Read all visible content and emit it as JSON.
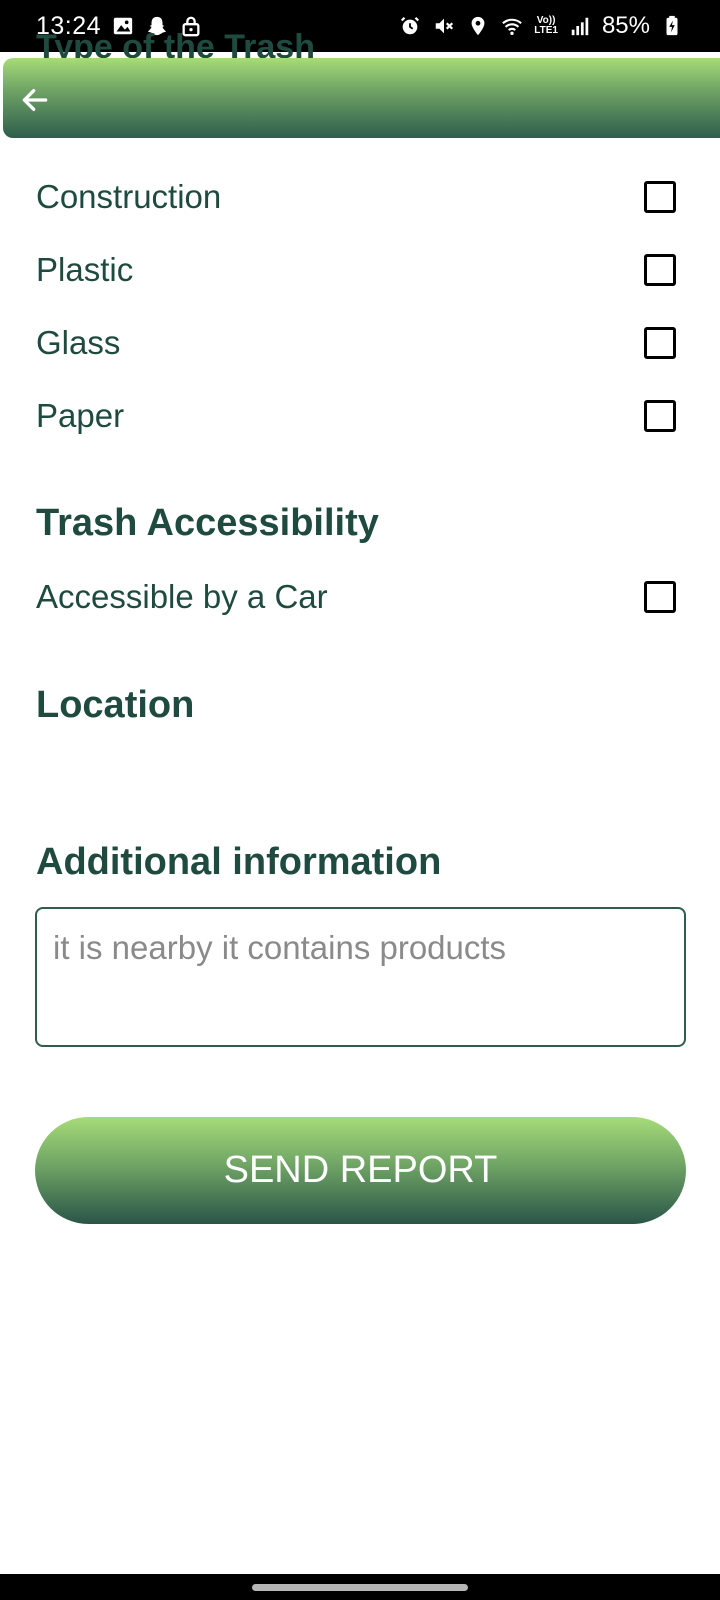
{
  "status_bar": {
    "time": "13:24",
    "battery": "85%",
    "volte_top": "Vo))",
    "volte_bottom": "LTE1"
  },
  "hidden_heading": "Type of the Trash",
  "trash_types": [
    {
      "label": "Construction",
      "checked": false
    },
    {
      "label": "Plastic",
      "checked": false
    },
    {
      "label": "Glass",
      "checked": false
    },
    {
      "label": "Paper",
      "checked": false
    }
  ],
  "accessibility": {
    "title": "Trash Accessibility",
    "option_label": "Accessible by a Car",
    "checked": false
  },
  "location": {
    "title": "Location"
  },
  "additional": {
    "title": "Additional information",
    "value": "it is nearby it contains products"
  },
  "send_button_label": "SEND REPORT",
  "colors": {
    "header_gradient_top": "#a6dc78",
    "header_gradient_bottom": "#2f5d4d",
    "text_primary": "#1f4a40",
    "placeholder_text": "#8a8a8a"
  },
  "icons": {
    "back": "arrow-left-icon"
  }
}
